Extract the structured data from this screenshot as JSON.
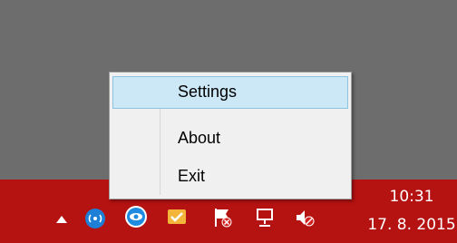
{
  "context_menu": {
    "items": [
      {
        "label": "Settings",
        "selected": true
      },
      {
        "label": "About",
        "selected": false
      },
      {
        "label": "Exit",
        "selected": false
      }
    ]
  },
  "taskbar": {
    "color": "#b51212",
    "clock": {
      "time": "10:31",
      "date": "17. 8. 2015"
    },
    "tray_icons": [
      "show-hidden-icons-arrow",
      "wifi-broadcast-icon",
      "eye-icon",
      "notification-icon",
      "action-center-icon",
      "network-icon",
      "volume-muted-icon"
    ]
  },
  "colors": {
    "menu_background": "#f0f0f0",
    "menu_selection": "#cce8f6",
    "menu_selection_border": "#8cc4e0",
    "desktop": "#6d6d6d"
  }
}
